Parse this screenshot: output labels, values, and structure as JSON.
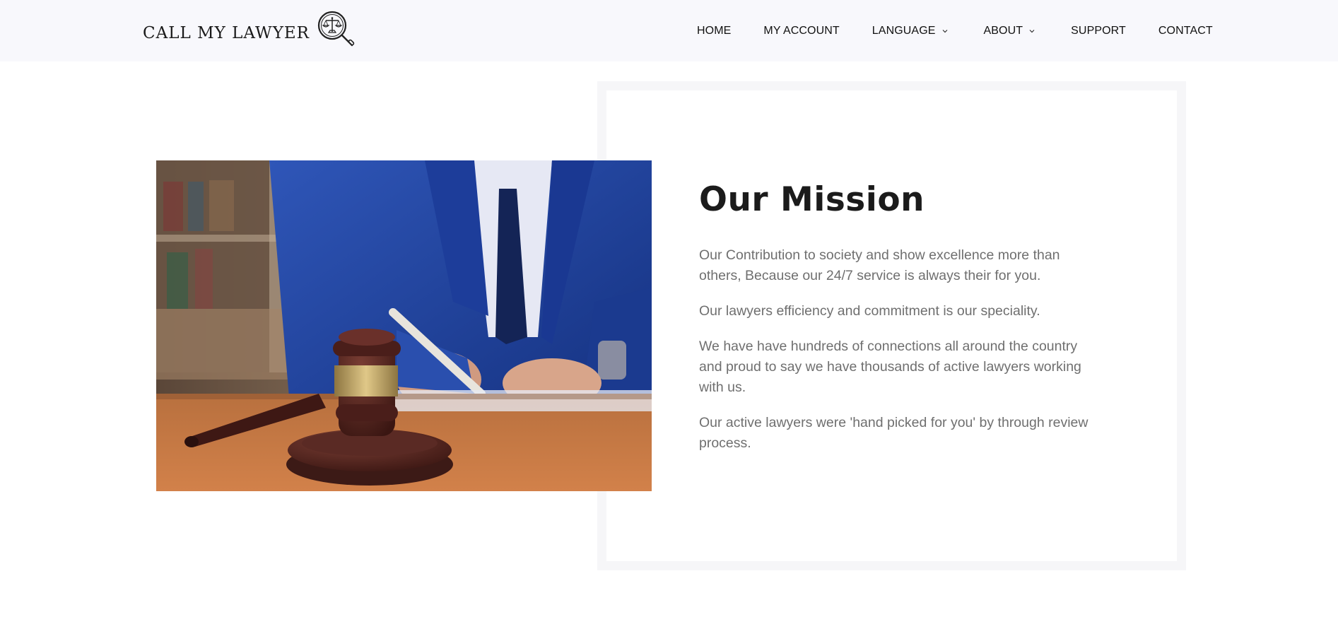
{
  "header": {
    "logo_text": "CALL MY LAWYER",
    "logo_icon": "scales-magnifier-icon",
    "nav": [
      {
        "label": "HOME",
        "has_dropdown": false
      },
      {
        "label": "MY ACCOUNT",
        "has_dropdown": false
      },
      {
        "label": "LANGUAGE",
        "has_dropdown": true
      },
      {
        "label": "ABOUT",
        "has_dropdown": true
      },
      {
        "label": "SUPPORT",
        "has_dropdown": false
      },
      {
        "label": "CONTACT",
        "has_dropdown": false
      }
    ]
  },
  "mission": {
    "title": "Our Mission",
    "paragraphs": [
      "Our Contribution to society and show excellence more than others, Because our 24/7 service is always their for you.",
      "Our lawyers efficiency and commitment is our speciality.",
      "We have have hundreds of connections all around the country and proud to say we have thousands of active lawyers working with us.",
      "Our active lawyers were 'hand picked for you' by through review process."
    ]
  },
  "colors": {
    "header_bg": "#f8f8fc",
    "card_border": "#f6f6f8",
    "title": "#1b1b1b",
    "body_text": "#6f6f6f"
  }
}
